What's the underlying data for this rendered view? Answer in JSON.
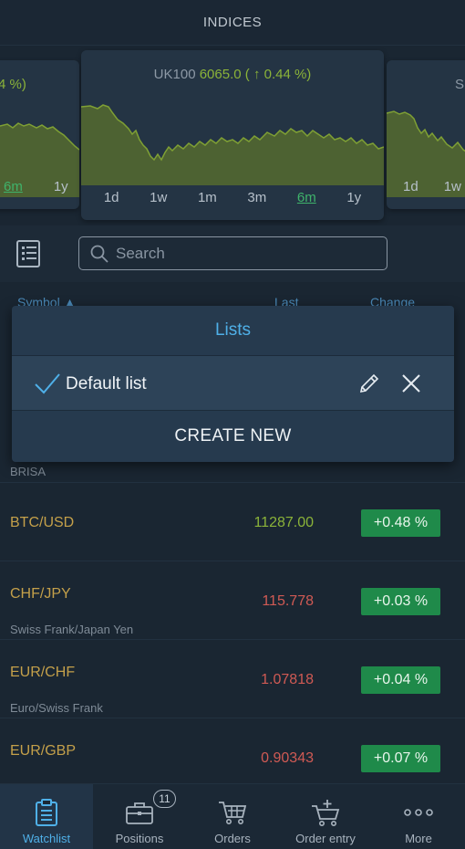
{
  "header": {
    "title": "INDICES"
  },
  "carousel": {
    "left_card": {
      "title_suffix": "4 %)",
      "ranges": [
        "6m",
        "1y"
      ],
      "active_range": "6m"
    },
    "center_card": {
      "symbol": "UK100",
      "price": "6065.0",
      "change": "( ↑ 0.44 %)",
      "ranges": [
        "1d",
        "1w",
        "1m",
        "3m",
        "6m",
        "1y"
      ],
      "active_range": "6m"
    },
    "right_card": {
      "title_prefix": "SI",
      "ranges": [
        "1d",
        "1w"
      ]
    }
  },
  "toolbar": {
    "search_placeholder": "Search"
  },
  "table_header": {
    "symbol": "Symbol ▲",
    "last": "Last",
    "change": "Change"
  },
  "popup": {
    "title": "Lists",
    "items": [
      {
        "name": "Default list",
        "selected": true
      }
    ],
    "create_label": "CREATE NEW"
  },
  "partial_row": {
    "description": "BRISA"
  },
  "rows": [
    {
      "symbol": "BTC/USD",
      "description": "",
      "last": "11287.00",
      "direction": "up",
      "change": "+0.48 %"
    },
    {
      "symbol": "CHF/JPY",
      "description": "Swiss Frank/Japan Yen",
      "last": "115.778",
      "direction": "down",
      "change": "+0.03 %"
    },
    {
      "symbol": "EUR/CHF",
      "description": "Euro/Swiss Frank",
      "last": "1.07818",
      "direction": "down",
      "change": "+0.04 %"
    },
    {
      "symbol": "EUR/GBP",
      "description": "",
      "last": "0.90343",
      "direction": "down",
      "change": "+0.07 %"
    }
  ],
  "nav": {
    "items": [
      {
        "label": "Watchlist",
        "icon": "clipboard-icon",
        "active": true
      },
      {
        "label": "Positions",
        "icon": "briefcase-icon",
        "badge": "11"
      },
      {
        "label": "Orders",
        "icon": "cart-icon"
      },
      {
        "label": "Order entry",
        "icon": "cart-plus-icon"
      },
      {
        "label": "More",
        "icon": "more-dots-icon"
      }
    ]
  },
  "colors": {
    "accent": "#4fb0e8",
    "up": "#8bb339",
    "down": "#d05a54",
    "change_bg": "#1f8a4a",
    "symbol": "#c4a04a"
  }
}
